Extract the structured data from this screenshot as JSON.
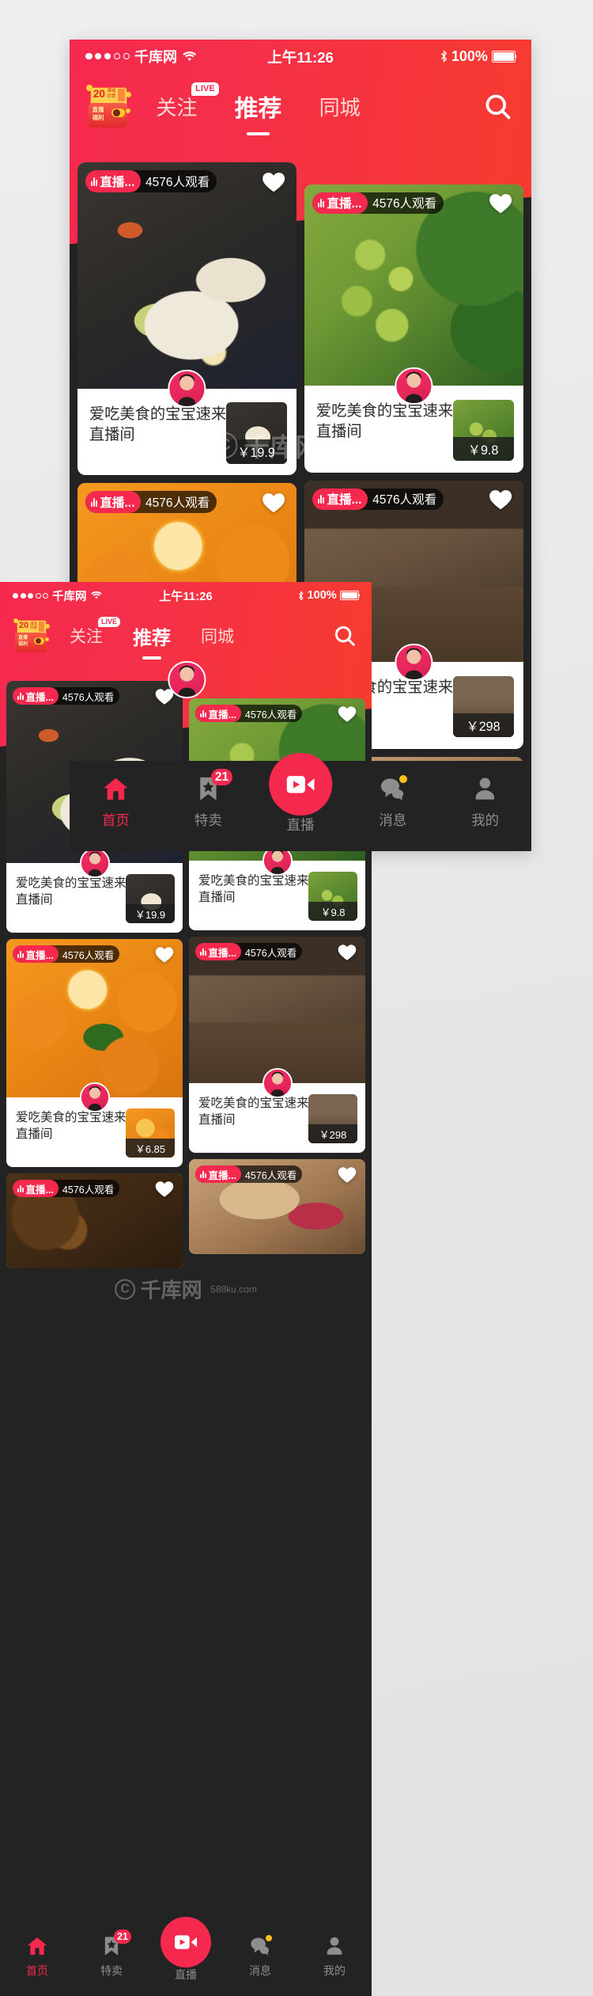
{
  "status_bar": {
    "carrier": "千库网",
    "signal_dots_filled": 3,
    "signal_dots_total": 5,
    "wifi_icon": "wifi-icon",
    "time": "上午11:26",
    "bluetooth_icon": "bluetooth-icon",
    "battery_percent": "100%"
  },
  "header": {
    "gift_icon": "live-gift-icon",
    "gift_amount": "20",
    "gift_label_top": "满减",
    "gift_label_bottom": "直播福利",
    "tabs": [
      {
        "label": "关注",
        "badge": "LIVE",
        "active": false
      },
      {
        "label": "推荐",
        "badge": "",
        "active": true
      },
      {
        "label": "同城",
        "badge": "",
        "active": false
      }
    ],
    "search_icon": "search-icon"
  },
  "colors": {
    "brand_red": "#f5294e",
    "header_gradient_start": "#f5294e",
    "header_gradient_end": "#f73b2f",
    "dark_bg": "#232323",
    "card_bg": "#ffffff",
    "inactive_gray": "#8d8d8d",
    "badge_yellow": "#ffc01f"
  },
  "feed": {
    "cards": [
      {
        "id": "card-noodles",
        "live_badge": "直播...",
        "viewers": "4576人观看",
        "favorite_icon": "heart-icon",
        "favorited": true,
        "title": "爱吃美食的宝宝速来直播间",
        "price": "￥19.9",
        "avatar_name": "host-avatar",
        "photo": "ph-noodle",
        "product_photo": "ph-prod-noodle"
      },
      {
        "id": "card-grapes",
        "live_badge": "直播...",
        "viewers": "4576人观看",
        "favorite_icon": "heart-icon",
        "favorited": true,
        "title": "爱吃美食的宝宝速来直播间",
        "price": "￥9.8",
        "avatar_name": "host-avatar",
        "photo": "ph-grape",
        "product_photo": "ph-prod-grape"
      },
      {
        "id": "card-oranges",
        "live_badge": "直播...",
        "viewers": "4576人观看",
        "favorite_icon": "heart-icon",
        "favorited": true,
        "title": "爱吃美食的宝宝速来直播间",
        "price": "￥6.85",
        "avatar_name": "host-avatar",
        "photo": "ph-orange",
        "product_photo": "ph-prod-orange"
      },
      {
        "id": "card-store",
        "live_badge": "直播...",
        "viewers": "4576人观看",
        "favorite_icon": "heart-icon",
        "favorited": true,
        "title": "爱吃美食的宝宝速来直播间",
        "price": "￥298",
        "avatar_name": "host-avatar",
        "photo": "ph-shop",
        "product_photo": "ph-prod-shop"
      },
      {
        "id": "card-beans",
        "live_badge": "直播...",
        "viewers": "4576人观看",
        "favorite_icon": "heart-icon",
        "favorited": true,
        "title": "",
        "price": "",
        "photo": "ph-beans",
        "product_photo": ""
      },
      {
        "id": "card-dessert",
        "live_badge": "直播...",
        "viewers": "4576人观看",
        "favorite_icon": "heart-icon",
        "favorited": true,
        "title": "",
        "price": "",
        "photo": "ph-cake",
        "product_photo": ""
      }
    ]
  },
  "tabbar": {
    "items": [
      {
        "label": "首页",
        "icon": "home-icon",
        "active": true,
        "badge": "",
        "dot": false
      },
      {
        "label": "特卖",
        "icon": "bookmark-star-icon",
        "active": false,
        "badge": "21",
        "dot": false
      },
      {
        "label": "直播",
        "icon": "video-camera-icon",
        "active": false,
        "badge": "",
        "dot": false,
        "fab": true
      },
      {
        "label": "消息",
        "icon": "chat-bubble-icon",
        "active": false,
        "badge": "",
        "dot": true
      },
      {
        "label": "我的",
        "icon": "user-icon",
        "active": false,
        "badge": "",
        "dot": false
      }
    ]
  },
  "watermark": {
    "brand": "千库网",
    "sub": "588ku.com",
    "logo": "copyright-icon"
  }
}
